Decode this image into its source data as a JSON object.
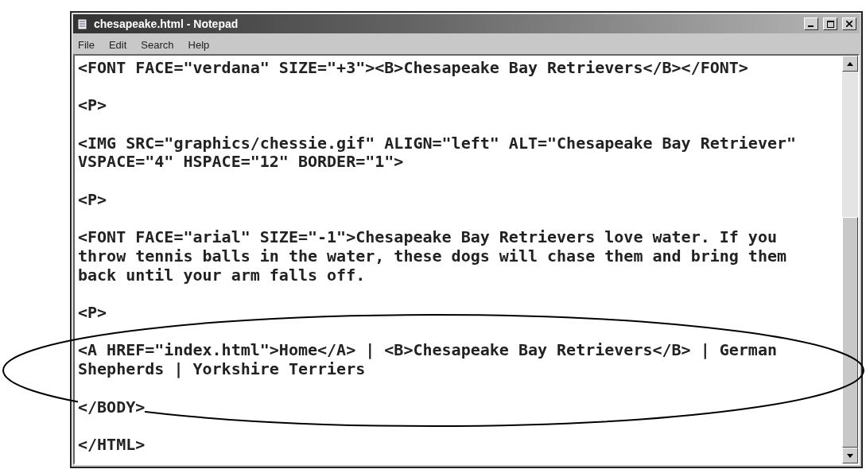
{
  "window": {
    "title": "chesapeake.html - Notepad"
  },
  "menu": [
    {
      "label": "File"
    },
    {
      "label": "Edit"
    },
    {
      "label": "Search"
    },
    {
      "label": "Help"
    }
  ],
  "document": {
    "paragraphs": [
      {
        "lines": [
          "<FONT FACE=\"verdana\" SIZE=\"+3\"><B>Chesapeake Bay Retrievers</B></FONT>"
        ]
      },
      {
        "lines": [
          "<P>"
        ]
      },
      {
        "lines": [
          "<IMG SRC=\"graphics/chessie.gif\" ALIGN=\"left\" ALT=\"Chesapeake Bay Retriever\"",
          "VSPACE=\"4\" HSPACE=\"12\" BORDER=\"1\">"
        ]
      },
      {
        "lines": [
          "<P>"
        ]
      },
      {
        "lines": [
          "<FONT FACE=\"arial\" SIZE=\"-1\">Chesapeake Bay Retrievers love water. If you",
          "throw tennis balls in the water, these dogs will chase them and bring them",
          "back until your arm falls off."
        ]
      },
      {
        "lines": [
          "<P>"
        ]
      },
      {
        "lines": [
          "<A HREF=\"index.html\">Home</A> | <B>Chesapeake Bay Retrievers</B> | German",
          "Shepherds | Yorkshire Terriers"
        ]
      },
      {
        "lines": [
          "</BODY>"
        ]
      },
      {
        "lines": [
          "</HTML>"
        ]
      }
    ]
  }
}
